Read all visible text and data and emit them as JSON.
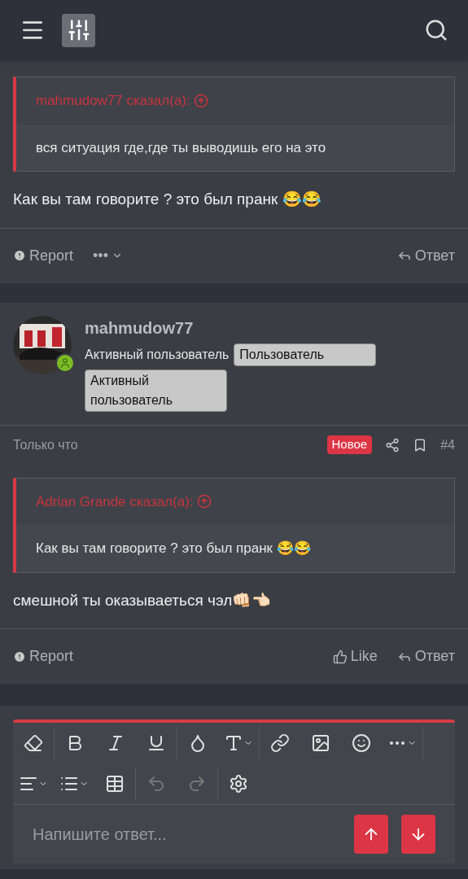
{
  "posts": [
    {
      "quote": {
        "author": "mahmudow77 сказал(а):",
        "text": "вся ситуация где,где ты выводишь его на это"
      },
      "message": "Как вы там говорите ? это был пранк 😂😂",
      "actions": {
        "report": "Report",
        "more": "•••",
        "reply": "Ответ"
      }
    },
    {
      "author": {
        "name": "mahmudow77",
        "title": "Активный пользователь",
        "online": true,
        "badges": [
          "Пользователь",
          "Активный пользователь"
        ]
      },
      "meta": {
        "time": "Только что",
        "new_label": "Новое",
        "number": "#4"
      },
      "quote": {
        "author": "Adrian Grande сказал(а):",
        "text": "Как вы там говорите ? это был пранк 😂😂"
      },
      "message": "смешной ты оказываеться чэл👊🏻👈🏻",
      "actions": {
        "report": "Report",
        "like": "Like",
        "reply": "Ответ"
      }
    }
  ],
  "editor": {
    "placeholder": "Напишите ответ..."
  }
}
